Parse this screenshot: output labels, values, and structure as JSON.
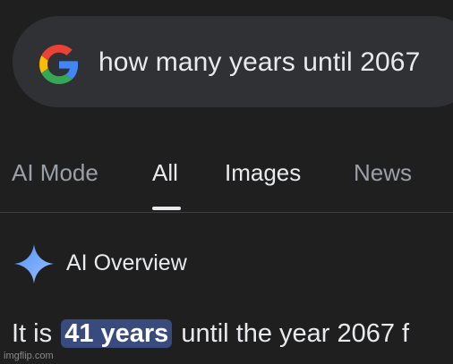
{
  "search": {
    "query": "how many years until 2067",
    "logo_icon": "google-g-icon"
  },
  "tabs": [
    {
      "label": "AI Mode",
      "active": false
    },
    {
      "label": "All",
      "active": true
    },
    {
      "label": "Images",
      "active": false
    },
    {
      "label": "News",
      "active": false
    }
  ],
  "ai_overview": {
    "icon": "sparkle-icon",
    "title": "AI Overview",
    "answer_prefix": "It is",
    "answer_highlight": "41 years",
    "answer_suffix": "until the year 2067 f"
  },
  "watermark": "imgflip.com",
  "colors": {
    "background": "#1f1f1f",
    "search_bar": "#303134",
    "highlight": "#394a7d",
    "sparkle": "#8ab4f8"
  }
}
